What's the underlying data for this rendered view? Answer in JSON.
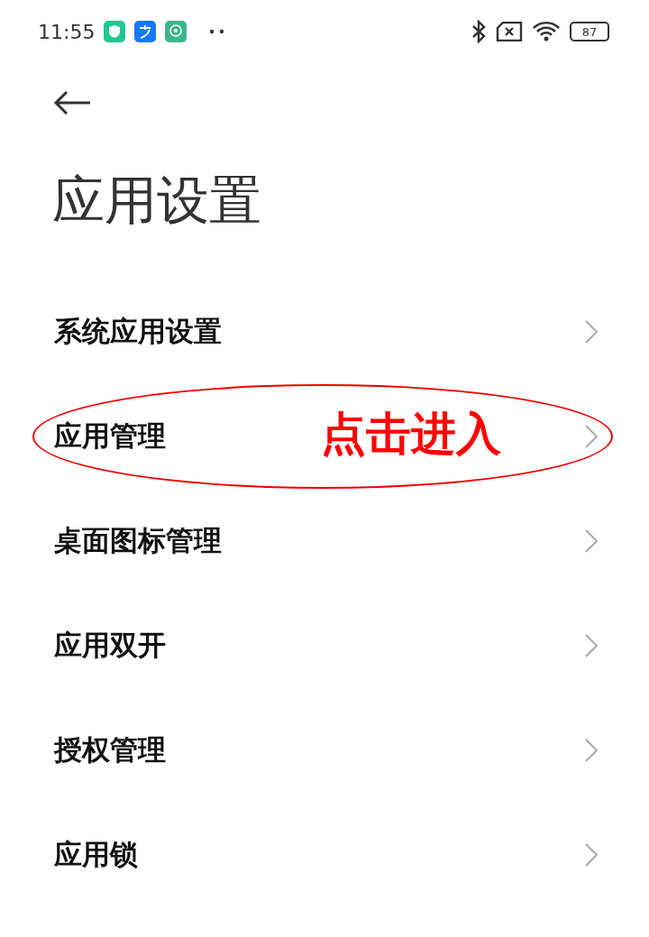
{
  "status_bar": {
    "time": "11:55",
    "battery": "87"
  },
  "title": "应用设置",
  "items": [
    {
      "label": "系统应用设置",
      "highlighted": false
    },
    {
      "label": "应用管理",
      "highlighted": true
    },
    {
      "label": "桌面图标管理",
      "highlighted": false
    },
    {
      "label": "应用双开",
      "highlighted": false
    },
    {
      "label": "授权管理",
      "highlighted": false
    },
    {
      "label": "应用锁",
      "highlighted": false
    }
  ],
  "annotation": {
    "text": "点击进入"
  }
}
